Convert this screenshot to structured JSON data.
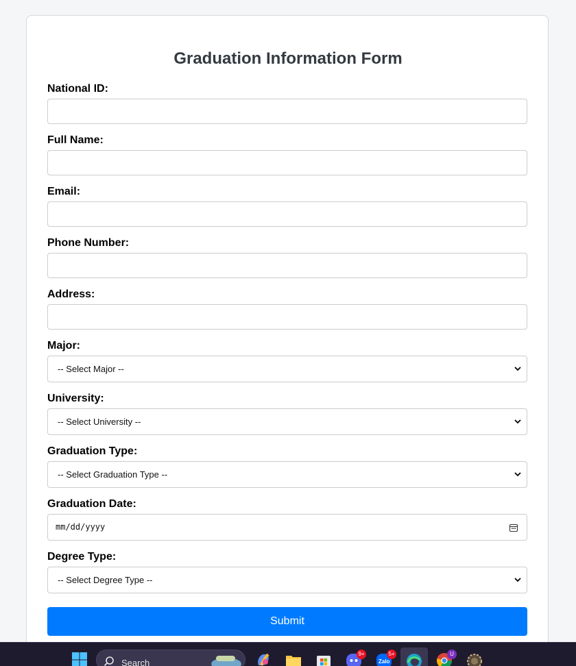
{
  "form": {
    "title": "Graduation Information Form",
    "national_id_label": "National ID:",
    "full_name_label": "Full Name:",
    "email_label": "Email:",
    "phone_label": "Phone Number:",
    "address_label": "Address:",
    "major_label": "Major:",
    "major_selected": "-- Select Major --",
    "university_label": "University:",
    "university_selected": "-- Select University --",
    "grad_type_label": "Graduation Type:",
    "grad_type_selected": "-- Select Graduation Type --",
    "grad_date_label": "Graduation Date:",
    "grad_date_placeholder": "mm/dd/yyyy",
    "degree_type_label": "Degree Type:",
    "degree_type_selected": "-- Select Degree Type --",
    "submit_label": "Submit"
  },
  "taskbar": {
    "search_label": "Search",
    "discord_badge": "9+",
    "zalo_badge": "5+",
    "chrome_badge": "U"
  },
  "colors": {
    "accent": "#007bff",
    "page_bg": "#f4f6f8",
    "title": "#343a40"
  },
  "icons": [
    "windows-start-icon",
    "search-icon",
    "copilot-icon",
    "file-explorer-icon",
    "store-icon",
    "discord-icon",
    "zalo-icon",
    "edge-icon",
    "chrome-icon",
    "settings-icon",
    "calendar-icon",
    "chevron-down-icon"
  ]
}
